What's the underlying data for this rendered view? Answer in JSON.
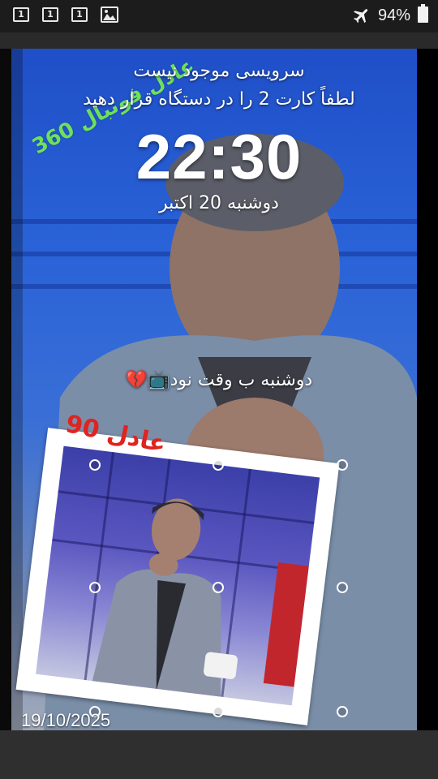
{
  "status_bar": {
    "sim_slots": [
      "1",
      "1",
      "1"
    ],
    "gallery_icon": "image-icon",
    "airplane_icon": "airplane-icon",
    "battery_percent": "94%",
    "battery_icon": "battery-icon"
  },
  "lockscreen": {
    "carrier_line1": "سرویسی موجود نیست",
    "carrier_line2": "لطفاً کارت 2 را در دستگاه قرار دهید",
    "clock": "22:30",
    "date": "دوشنبه 20 اکتبر",
    "owner_info": "دوشنبه ب وقت نود📺💔"
  },
  "wallpaper": {
    "watermark_green": "عادل فوتبال 360",
    "watermark_red": "عادل 90",
    "footer_date": "19/10/2025"
  },
  "colors": {
    "wallpaper_blue": "#2a63d8",
    "watermark_green": "#6fe05a",
    "watermark_red": "#e0231e"
  }
}
